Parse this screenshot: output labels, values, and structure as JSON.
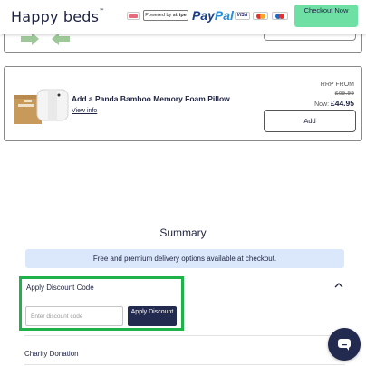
{
  "header": {
    "logo_text": "Happy beds",
    "logo_mark": "™",
    "stripe_badge_prefix": "Powered by",
    "stripe_badge_brand": "stripe",
    "paypal_pay": "Pay",
    "paypal_pal": "Pal",
    "visa": "VISA",
    "checkout_label": "Checkout Now"
  },
  "upsell": {
    "title": "Add a Panda Bamboo Memory Foam Pillow",
    "view_info": "View info",
    "rrp_label": "RRP FROM",
    "rrp_price": "£69.99",
    "now_label": "Now:",
    "now_price": "£44.95",
    "add_label": "Add"
  },
  "summary": {
    "title": "Summary",
    "delivery_banner": "Free and premium delivery options available at checkout.",
    "discount_label": "Apply Discount Code",
    "discount_placeholder": "Enter discount code",
    "apply_label": "Apply Discount",
    "charity_label": "Charity Donation"
  },
  "icons": {
    "chevron": "chevron-up-icon",
    "chat": "chat-icon",
    "pillow_image": "pillow-product-image",
    "previous_upsell_image": "green-arrows-image"
  },
  "colors": {
    "brand_navy": "#1e2340",
    "checkout_green": "#6ee0a4",
    "highlight_green": "#1fb24a",
    "banner_blue": "#dbe7fb",
    "button_navy": "#232a4f"
  }
}
